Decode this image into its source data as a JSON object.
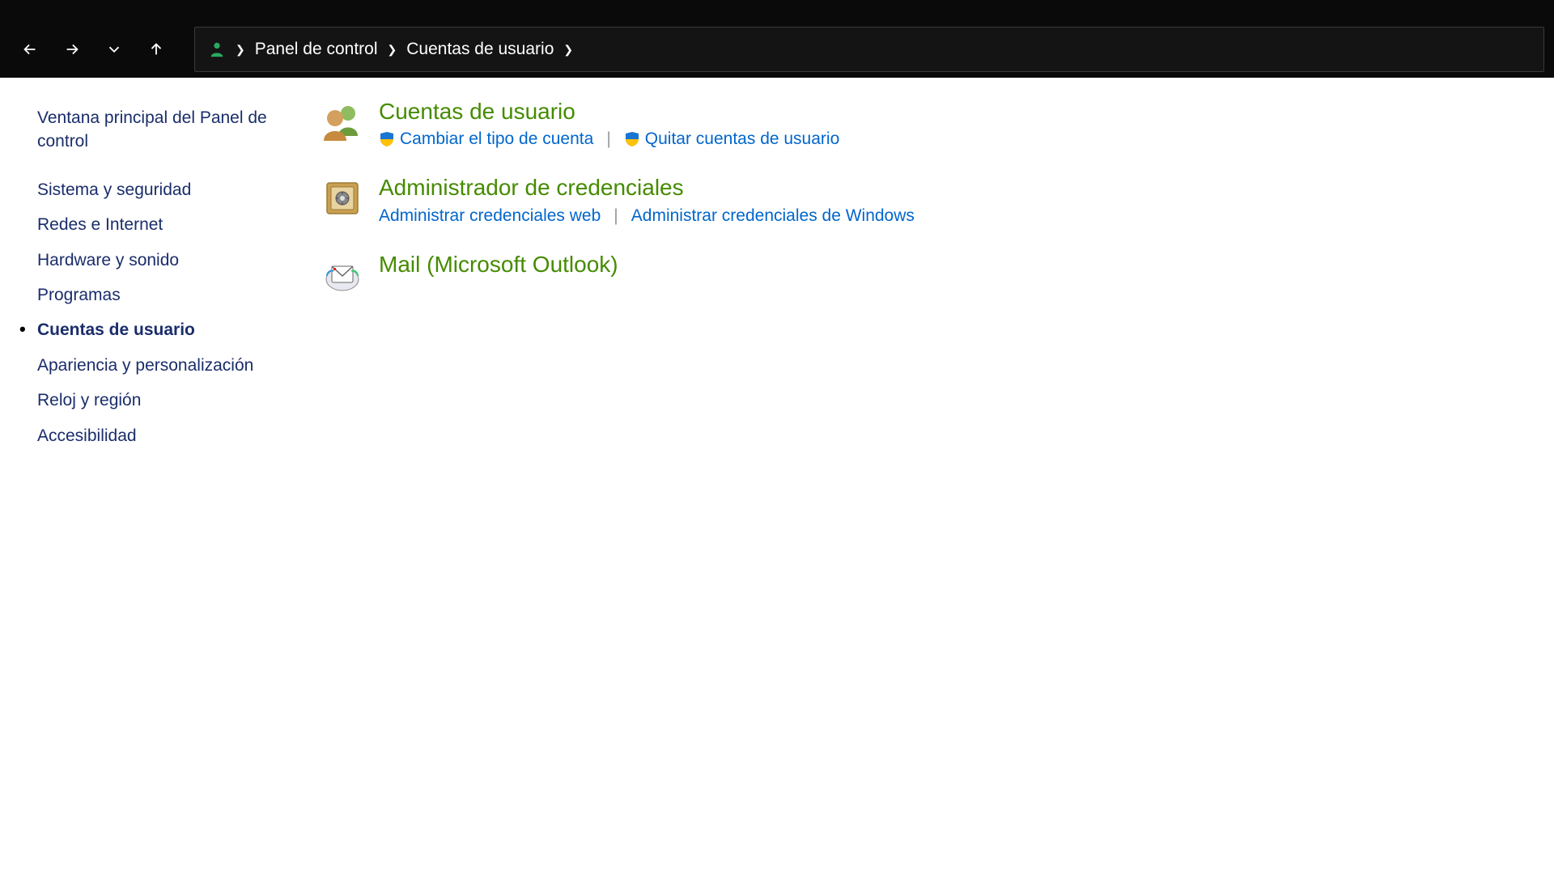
{
  "breadcrumb": {
    "root": "Panel de control",
    "current": "Cuentas de usuario"
  },
  "sidebar": {
    "home": "Ventana principal del Panel de control",
    "items": [
      {
        "label": "Sistema y seguridad",
        "active": false
      },
      {
        "label": "Redes e Internet",
        "active": false
      },
      {
        "label": "Hardware y sonido",
        "active": false
      },
      {
        "label": "Programas",
        "active": false
      },
      {
        "label": "Cuentas de usuario",
        "active": true
      },
      {
        "label": "Apariencia y personalización",
        "active": false
      },
      {
        "label": "Reloj y región",
        "active": false
      },
      {
        "label": "Accesibilidad",
        "active": false
      }
    ]
  },
  "categories": [
    {
      "title": "Cuentas de usuario",
      "links": [
        {
          "label": "Cambiar el tipo de cuenta",
          "shield": true
        },
        {
          "label": "Quitar cuentas de usuario",
          "shield": true
        }
      ]
    },
    {
      "title": "Administrador de credenciales",
      "links": [
        {
          "label": "Administrar credenciales web",
          "shield": false
        },
        {
          "label": "Administrar credenciales de Windows",
          "shield": false
        }
      ]
    },
    {
      "title": "Mail (Microsoft Outlook)",
      "links": []
    }
  ]
}
